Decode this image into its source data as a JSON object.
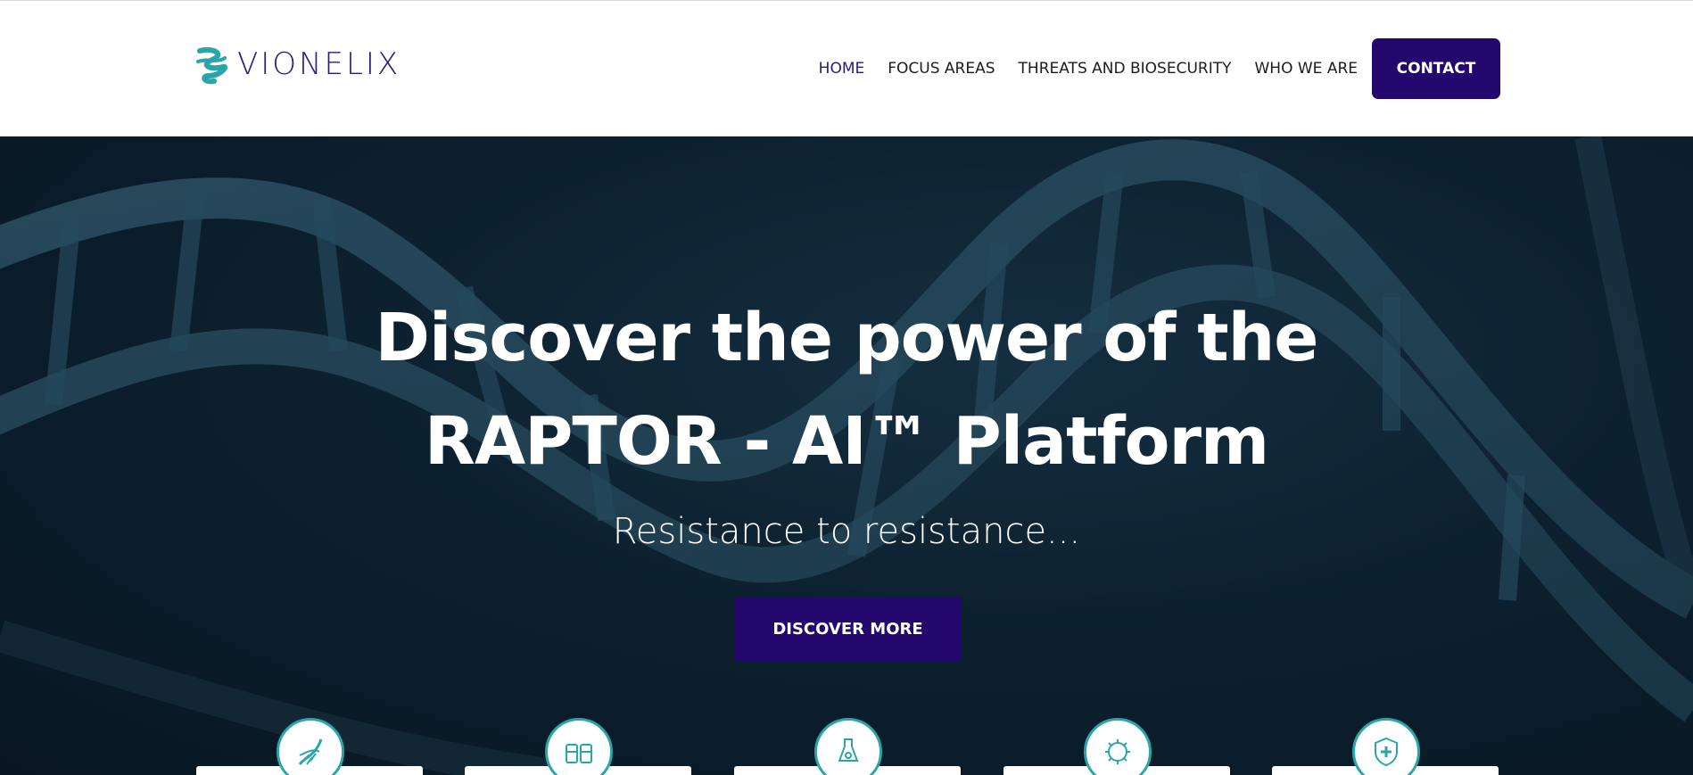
{
  "brand": {
    "name": "VIONELIX",
    "logo_icon": "dna-helix-icon",
    "logo_color": "#2aa6a8",
    "text_color": "#2b1a7a"
  },
  "nav": {
    "items": [
      {
        "label": "HOME",
        "active": true
      },
      {
        "label": "FOCUS AREAS",
        "active": false
      },
      {
        "label": "THREATS AND BIOSECURITY",
        "active": false
      },
      {
        "label": "WHO WE ARE",
        "active": false
      }
    ],
    "contact_label": "CONTACT"
  },
  "hero": {
    "title_line1": "Discover the power of the",
    "title_line2": "RAPTOR - AI™ Platform",
    "subtitle": "Resistance to resistance...",
    "cta_label": "DISCOVER MORE",
    "background": "dna-helix-image"
  },
  "cards": [
    {
      "icon": "dna-strand-icon"
    },
    {
      "icon": "vials-icon"
    },
    {
      "icon": "lab-bottle-icon"
    },
    {
      "icon": "virus-globe-icon"
    },
    {
      "icon": "shield-plus-icon"
    }
  ],
  "colors": {
    "primary": "#24086e",
    "accent": "#2aa6a8"
  }
}
